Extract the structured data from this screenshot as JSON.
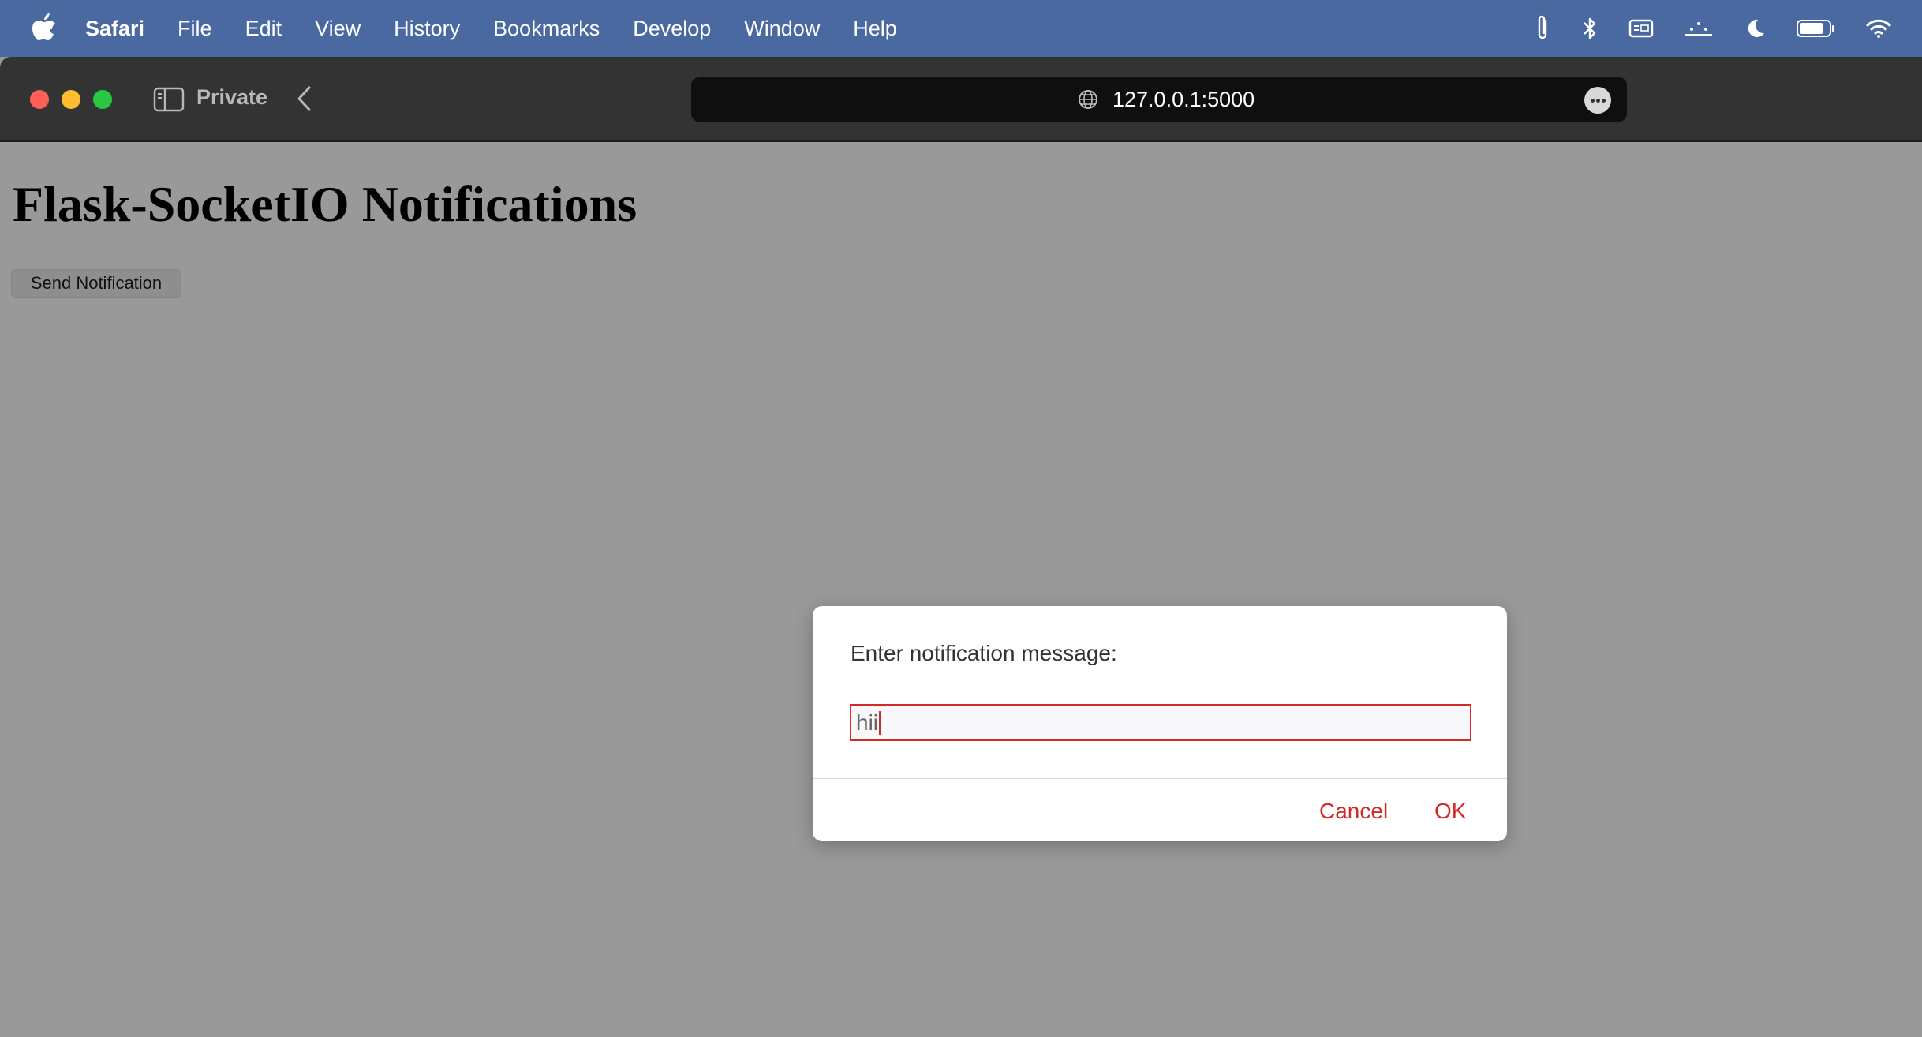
{
  "menubar": {
    "app_name": "Safari",
    "items": [
      "File",
      "Edit",
      "View",
      "History",
      "Bookmarks",
      "Develop",
      "Window",
      "Help"
    ],
    "status_icons": [
      "paperclip-icon",
      "bluetooth-icon",
      "keyboard-icon",
      "focus-dots-icon",
      "moon-icon",
      "battery-icon",
      "wifi-icon"
    ]
  },
  "toolbar": {
    "private_label": "Private",
    "url": "127.0.0.1:5000"
  },
  "page": {
    "title": "Flask-SocketIO Notifications",
    "send_button_label": "Send Notification"
  },
  "dialog": {
    "message": "Enter notification message:",
    "input_value": "hii",
    "cancel_label": "Cancel",
    "ok_label": "OK"
  },
  "colors": {
    "menubar_bg": "#4a69a0",
    "toolbar_bg": "#333333",
    "page_overlay": "#999999",
    "dialog_accent": "#d42a2a"
  }
}
